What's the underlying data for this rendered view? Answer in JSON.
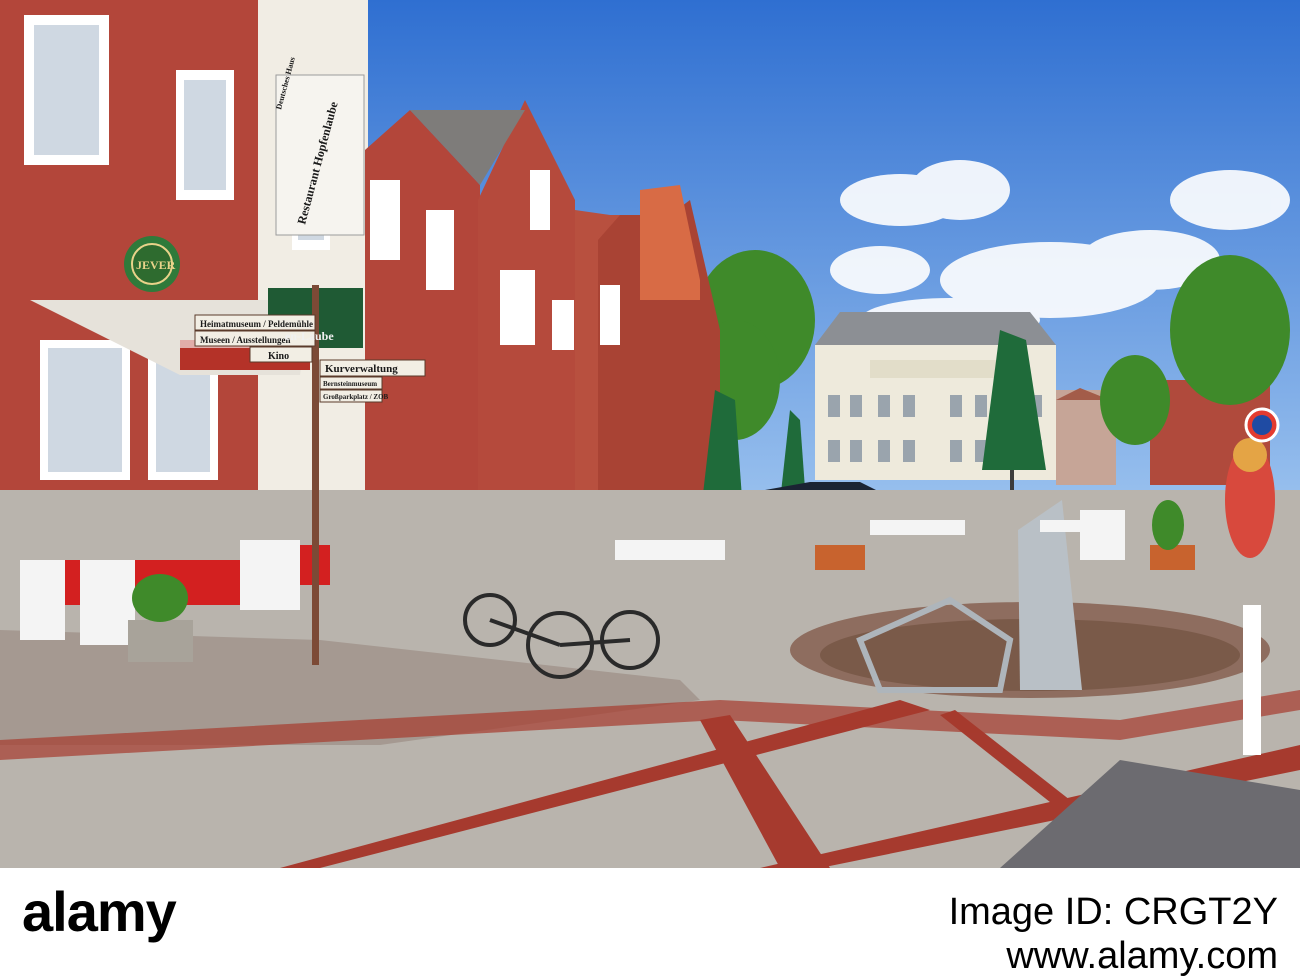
{
  "photo": {
    "description_tags": [
      "street-scene",
      "sky",
      "brick-buildings",
      "cafe",
      "fountain",
      "bicycles",
      "umbrellas"
    ],
    "colors": {
      "sky_top": "#2f6fd1",
      "sky_bottom": "#9cc3ef",
      "brick": "#b3463a",
      "brick_dark": "#8a3129",
      "plaster": "#f1ede4",
      "umbrella_green": "#1f6b3a",
      "pavement": "#b9b4ad",
      "pavement_red": "#a63a2e",
      "tree_green": "#3f8a2a"
    }
  },
  "signs": {
    "sign_1": "Heimatmuseum / Peldemühle",
    "sign_2": "Museen / Ausstellungen",
    "sign_3": "Kino",
    "sign_4": "Kurverwaltung",
    "sign_5": "Bernsteinmuseum",
    "sign_6": "Großparkplatz / ZOB",
    "restaurant_board": "Restaurant Hopfenlaube",
    "restaurant_board_small": "Deutsches Haus",
    "awning_text": "en-Laube",
    "jever_disc": "JEVER"
  },
  "footer": {
    "logo": "alamy",
    "image_id_label": "Image ID:",
    "image_id": "CRGT2Y",
    "url": "www.alamy.com"
  }
}
